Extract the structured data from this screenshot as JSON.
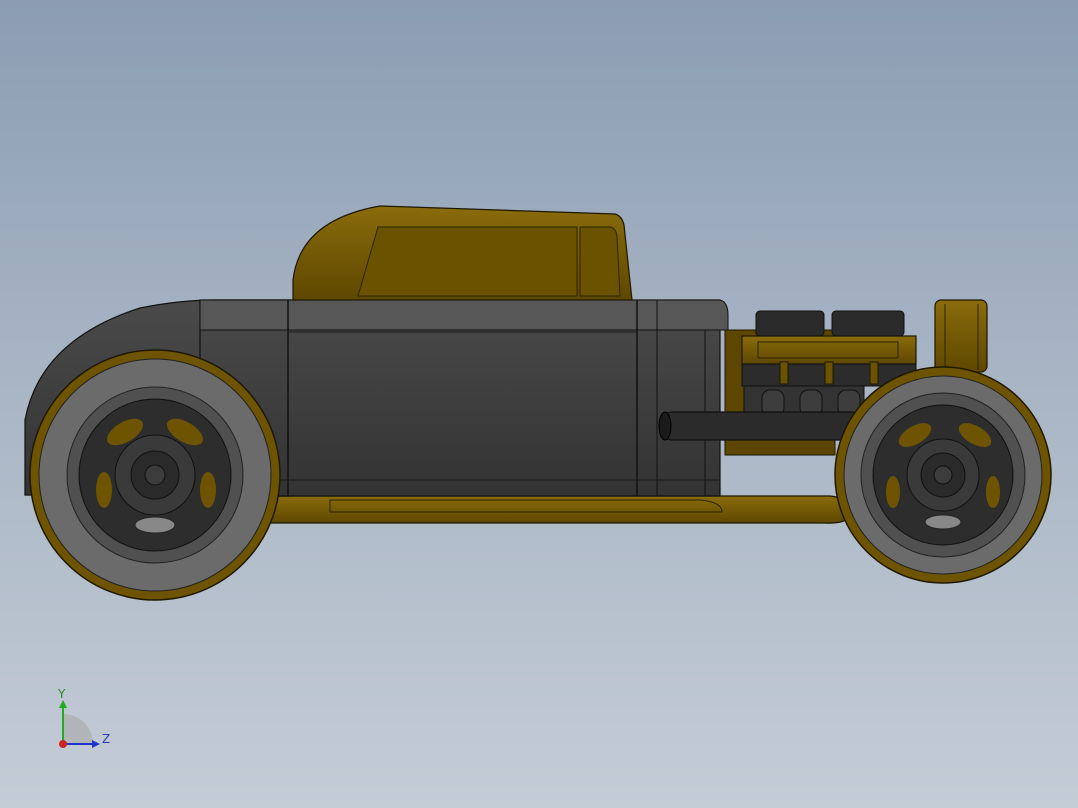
{
  "viewport": {
    "background_top": "#8b9db3",
    "background_bottom": "#c4ccd6"
  },
  "model": {
    "body_color": "#3b3b3b",
    "accent_color": "#6e5400",
    "tire_color": "#6d6d6d",
    "wheel_color": "#2e2e2e"
  },
  "triad": {
    "y_label": "Y",
    "z_label": "Z",
    "y_color": "#22aa22",
    "z_color": "#2233cc",
    "x_color": "#cc2222"
  }
}
